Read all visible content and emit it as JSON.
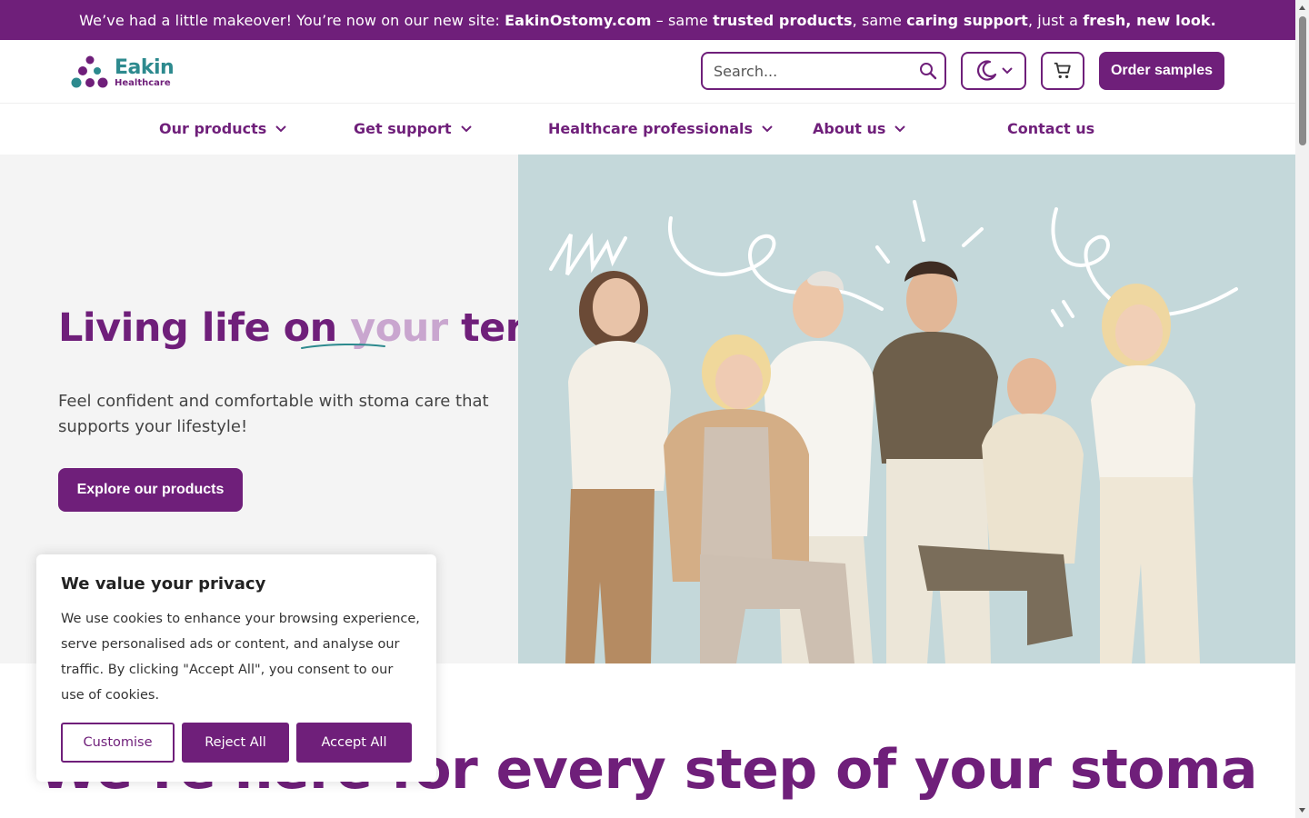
{
  "announcement": {
    "pre": "We’ve had a little makeover! You’re now on our new site: ",
    "site": "EakinOstomy.com",
    "mid1": " – same ",
    "bold1": "trusted products",
    "mid2": ", same ",
    "bold2": "caring support",
    "mid3": ", just a ",
    "bold3": "fresh, new look."
  },
  "header": {
    "logo_word": "Eakin",
    "logo_sub": "Healthcare",
    "search_placeholder": "Search...",
    "order_label": "Order samples",
    "theme_icon": "crescent-moon-icon",
    "cart_icon": "shopping-cart-icon"
  },
  "nav": {
    "items": [
      {
        "label": "Our products"
      },
      {
        "label": "Get support"
      },
      {
        "label": "Healthcare professionals"
      },
      {
        "label": "About us"
      },
      {
        "label": "Contact us"
      }
    ]
  },
  "hero": {
    "title_pre": "Living life on ",
    "title_accent": "your",
    "title_post": " terms",
    "subtitle": "Feel confident and comfortable with stoma care that supports your lifestyle!",
    "cta": "Explore our products"
  },
  "section": {
    "heading": "We’re here for every step of your stoma"
  },
  "cookie": {
    "title": "We value your privacy",
    "text": "We use cookies to enhance your browsing experience, serve personalised ads or content, and analyse our traffic. By clicking \"Accept All\", you consent to our use of cookies.",
    "customise": "Customise",
    "reject": "Reject All",
    "accept": "Accept All"
  },
  "colors": {
    "brand_purple": "#6f1f7a",
    "brand_teal": "#2d8a8e",
    "accent_lilac": "#c9a6cf",
    "photo_bg": "#c4d8da"
  }
}
